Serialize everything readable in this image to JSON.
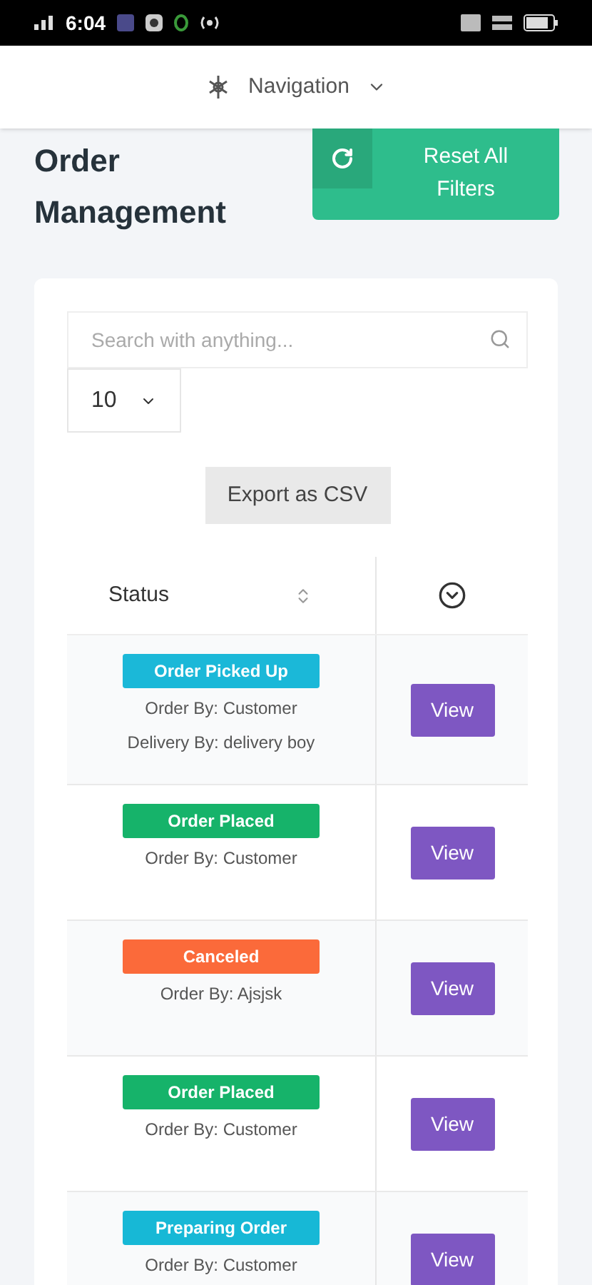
{
  "status_bar": {
    "time": "6:04"
  },
  "nav": {
    "label": "Navigation"
  },
  "page": {
    "title": "Order Management",
    "reset_button": "Reset All Filters"
  },
  "search": {
    "placeholder": "Search with anything..."
  },
  "page_size": {
    "value": "10"
  },
  "export_button": "Export as CSV",
  "table": {
    "columns": [
      {
        "label": "Status"
      }
    ],
    "rows": [
      {
        "status": "Order Picked Up",
        "color": "#1bb8d8",
        "lines": [
          "Order By: Customer",
          "Delivery By: delivery boy"
        ],
        "action": "View"
      },
      {
        "status": "Order Placed",
        "color": "#16b36a",
        "lines": [
          "Order By: Customer"
        ],
        "action": "View"
      },
      {
        "status": "Canceled",
        "color": "#fb6a3a",
        "lines": [
          "Order By: Ajsjsk"
        ],
        "action": "View"
      },
      {
        "status": "Order Placed",
        "color": "#16b36a",
        "lines": [
          "Order By: Customer"
        ],
        "action": "View"
      },
      {
        "status": "Preparing Order",
        "color": "#17b8d6",
        "lines": [
          "Order By: Customer"
        ],
        "action": "View"
      }
    ]
  }
}
